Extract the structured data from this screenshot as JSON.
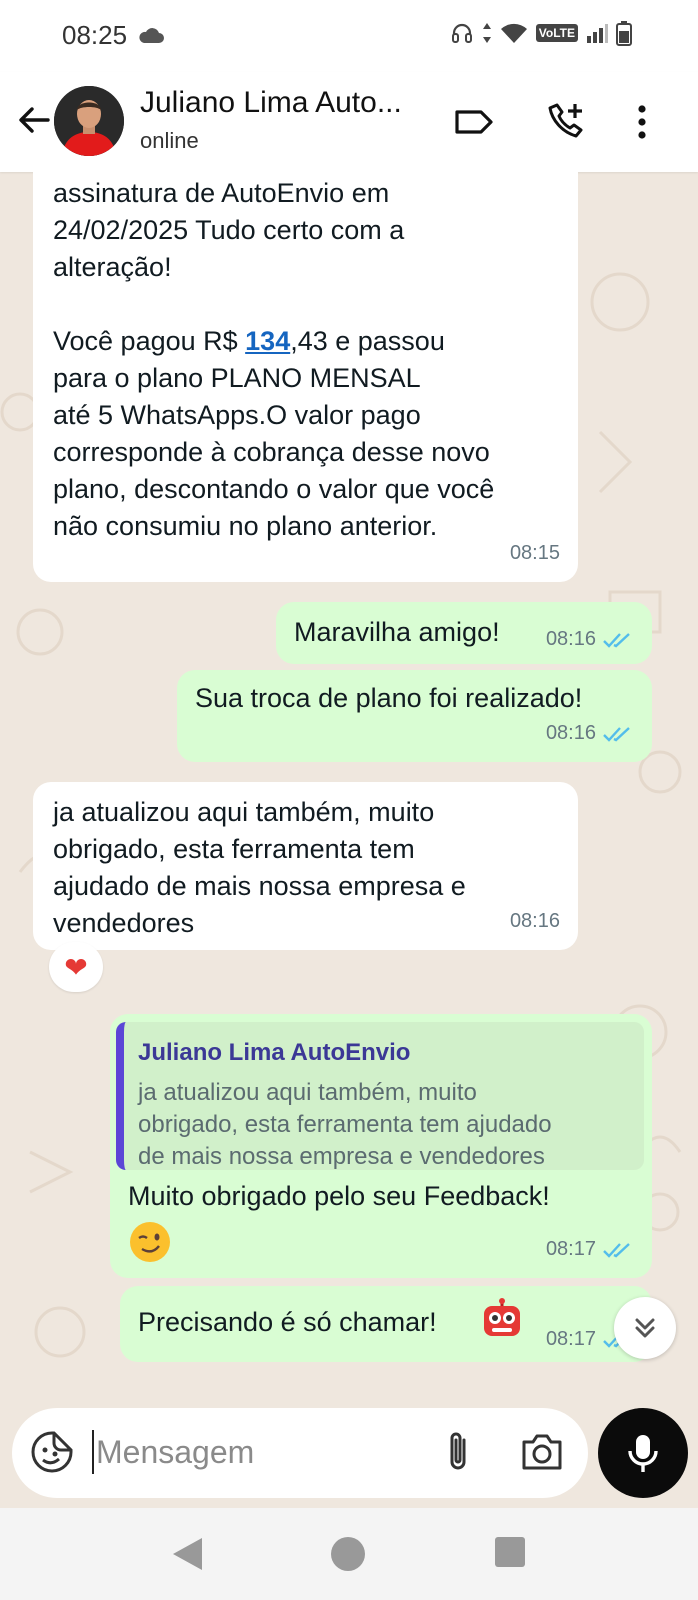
{
  "status_bar": {
    "time": "08:25",
    "volte": "VoLTE"
  },
  "header": {
    "contact_name": "Juliano Lima Auto...",
    "contact_status": "online"
  },
  "messages": [
    {
      "direction": "in",
      "text_part1": "assinatura de AutoEnvio em\n24/02/2025 Tudo certo com a\nalteração!\n\nVocê pagou R$ ",
      "link": "134",
      "text_part2": ",43 e passou\npara o plano PLANO MENSAL\naté 5 WhatsApps.O valor pago\ncorresponde à cobrança desse novo\nplano, descontando o valor que você\nnão consumiu no plano anterior.",
      "time": "08:15"
    },
    {
      "direction": "out",
      "text": "Maravilha amigo!",
      "time": "08:16",
      "status": "read"
    },
    {
      "direction": "out",
      "text": "Sua troca de plano foi realizado!",
      "time": "08:16",
      "status": "read"
    },
    {
      "direction": "in",
      "text": "ja atualizou aqui também, muito\nobrigado, esta ferramenta tem\najudado de mais nossa empresa e\nvendedores",
      "time": "08:16",
      "reaction": "❤"
    },
    {
      "direction": "out",
      "quote_author": "Juliano Lima AutoEnvio",
      "quote_text": "ja atualizou aqui também, muito\nobrigado, esta ferramenta tem ajudado\nde mais nossa empresa e vendedores",
      "text": "Muito obrigado pelo seu Feedback!",
      "time": "08:17",
      "status": "read"
    },
    {
      "direction": "out",
      "text": "Precisando é só chamar!",
      "time": "08:17",
      "status": "read"
    }
  ],
  "composer": {
    "placeholder": "Mensagem"
  },
  "colors": {
    "incoming": "#ffffff",
    "outgoing": "#d9fdd3",
    "wallpaper": "#efe7de",
    "read_ticks": "#53bdeb",
    "quote_bar": "#5b46d6"
  },
  "icons": [
    "cloud-icon",
    "headphones-icon",
    "wifi-icon",
    "signal-icon",
    "battery-icon",
    "back-arrow-icon",
    "label-icon",
    "add-call-icon",
    "more-icon",
    "heart-icon",
    "wink-emoji-icon",
    "robot-emoji-icon",
    "scroll-down-icon",
    "sticker-icon",
    "attach-icon",
    "camera-icon",
    "mic-icon",
    "nav-back-icon",
    "nav-home-icon",
    "nav-recents-icon"
  ]
}
